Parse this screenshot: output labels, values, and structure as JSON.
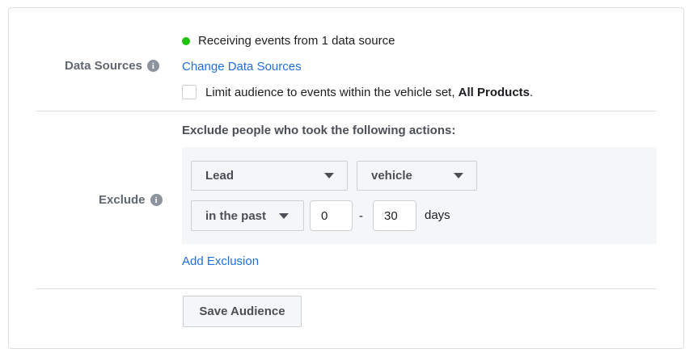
{
  "data_sources": {
    "label": "Data Sources",
    "info_icon": "i",
    "status_text": "Receiving events from 1 data source",
    "status_color": "#1ec40c",
    "change_link": "Change Data Sources",
    "limit_text": "Limit audience to events within the vehicle set, ",
    "limit_bold": "All Products",
    "limit_end": ".",
    "limit_checked": false
  },
  "exclude": {
    "label": "Exclude",
    "info_icon": "i",
    "heading": "Exclude people who took the following actions:",
    "event_select": "Lead",
    "object_select": "vehicle",
    "timeframe_select": "in the past",
    "from_value": "0",
    "separator": "-",
    "to_value": "30",
    "unit": "days",
    "add_link": "Add Exclusion"
  },
  "footer": {
    "save_label": "Save Audience"
  },
  "colors": {
    "link": "#216fdb",
    "label": "#606770",
    "border": "#dddfe2"
  }
}
